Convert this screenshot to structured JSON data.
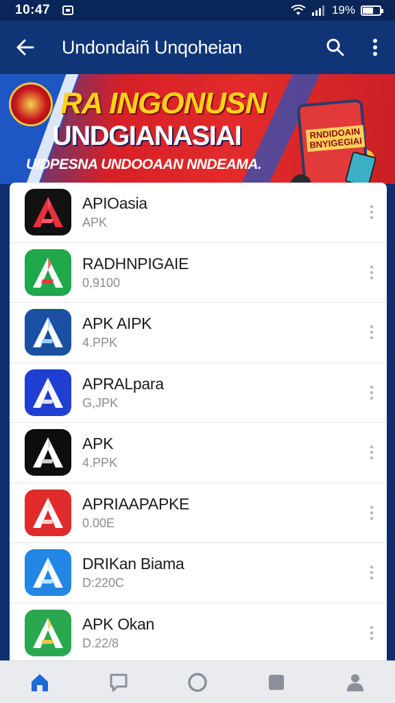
{
  "status_bar": {
    "time": "10:47",
    "battery": "19%"
  },
  "app_bar": {
    "title": "Undondaiñ Unqoheian"
  },
  "banner": {
    "title": "RA INGONUSN",
    "subtitle": "UNDGIANASIAI",
    "tagline": "UIDPESNA UNDOOAAN NNDEAMA.",
    "poster_text": "RNDIDOAIN BNYIGEGIAI"
  },
  "apps": [
    {
      "name": "APIOasia",
      "sub": "APK",
      "icon": "apk-icon",
      "bg": "#111111",
      "fg": "#e8313a",
      "accent": "#ff5a66"
    },
    {
      "name": "RADHNPIGAIE",
      "sub": "0,9100",
      "icon": "apk-icon",
      "bg": "#1fa84a",
      "fg": "#ffffff",
      "accent": "#e23a3a"
    },
    {
      "name": "APK AIPK",
      "sub": "4.PPK",
      "icon": "apk-icon",
      "bg": "#1a4fa3",
      "fg": "#ffffff",
      "accent": "#9ad0ff"
    },
    {
      "name": "APRALpara",
      "sub": "G,JPK",
      "icon": "apk-icon",
      "bg": "#1f3fd1",
      "fg": "#ffffff",
      "accent": "#d8e0ff"
    },
    {
      "name": "APK",
      "sub": "4.PPK",
      "icon": "apk-icon",
      "bg": "#0d0d0d",
      "fg": "#ffffff",
      "accent": "#cccccc"
    },
    {
      "name": "APRIAAPAPKE",
      "sub": "0.00E",
      "icon": "apk-icon",
      "bg": "#e02b2b",
      "fg": "#ffffff",
      "accent": "#ffd0d0"
    },
    {
      "name": "DRIKan Biama",
      "sub": "D:220C",
      "icon": "apk-icon",
      "bg": "#2186e6",
      "fg": "#ffffff",
      "accent": "#bfe3ff"
    },
    {
      "name": "APK Okan",
      "sub": "D.22/8",
      "icon": "apk-icon",
      "bg": "#2aa84f",
      "fg": "#ffffff",
      "accent": "#f3c33d"
    }
  ],
  "colors": {
    "app_bar": "#0f3577",
    "status_bar": "#0a2558",
    "nav_active": "#1e6ad8",
    "nav_inactive": "#8a8f99"
  },
  "bottom_nav": [
    {
      "name": "home",
      "icon": "home-icon"
    },
    {
      "name": "messages",
      "icon": "chat-icon"
    },
    {
      "name": "circle",
      "icon": "circle-icon"
    },
    {
      "name": "apps",
      "icon": "square-icon"
    },
    {
      "name": "profile",
      "icon": "profile-icon"
    }
  ]
}
